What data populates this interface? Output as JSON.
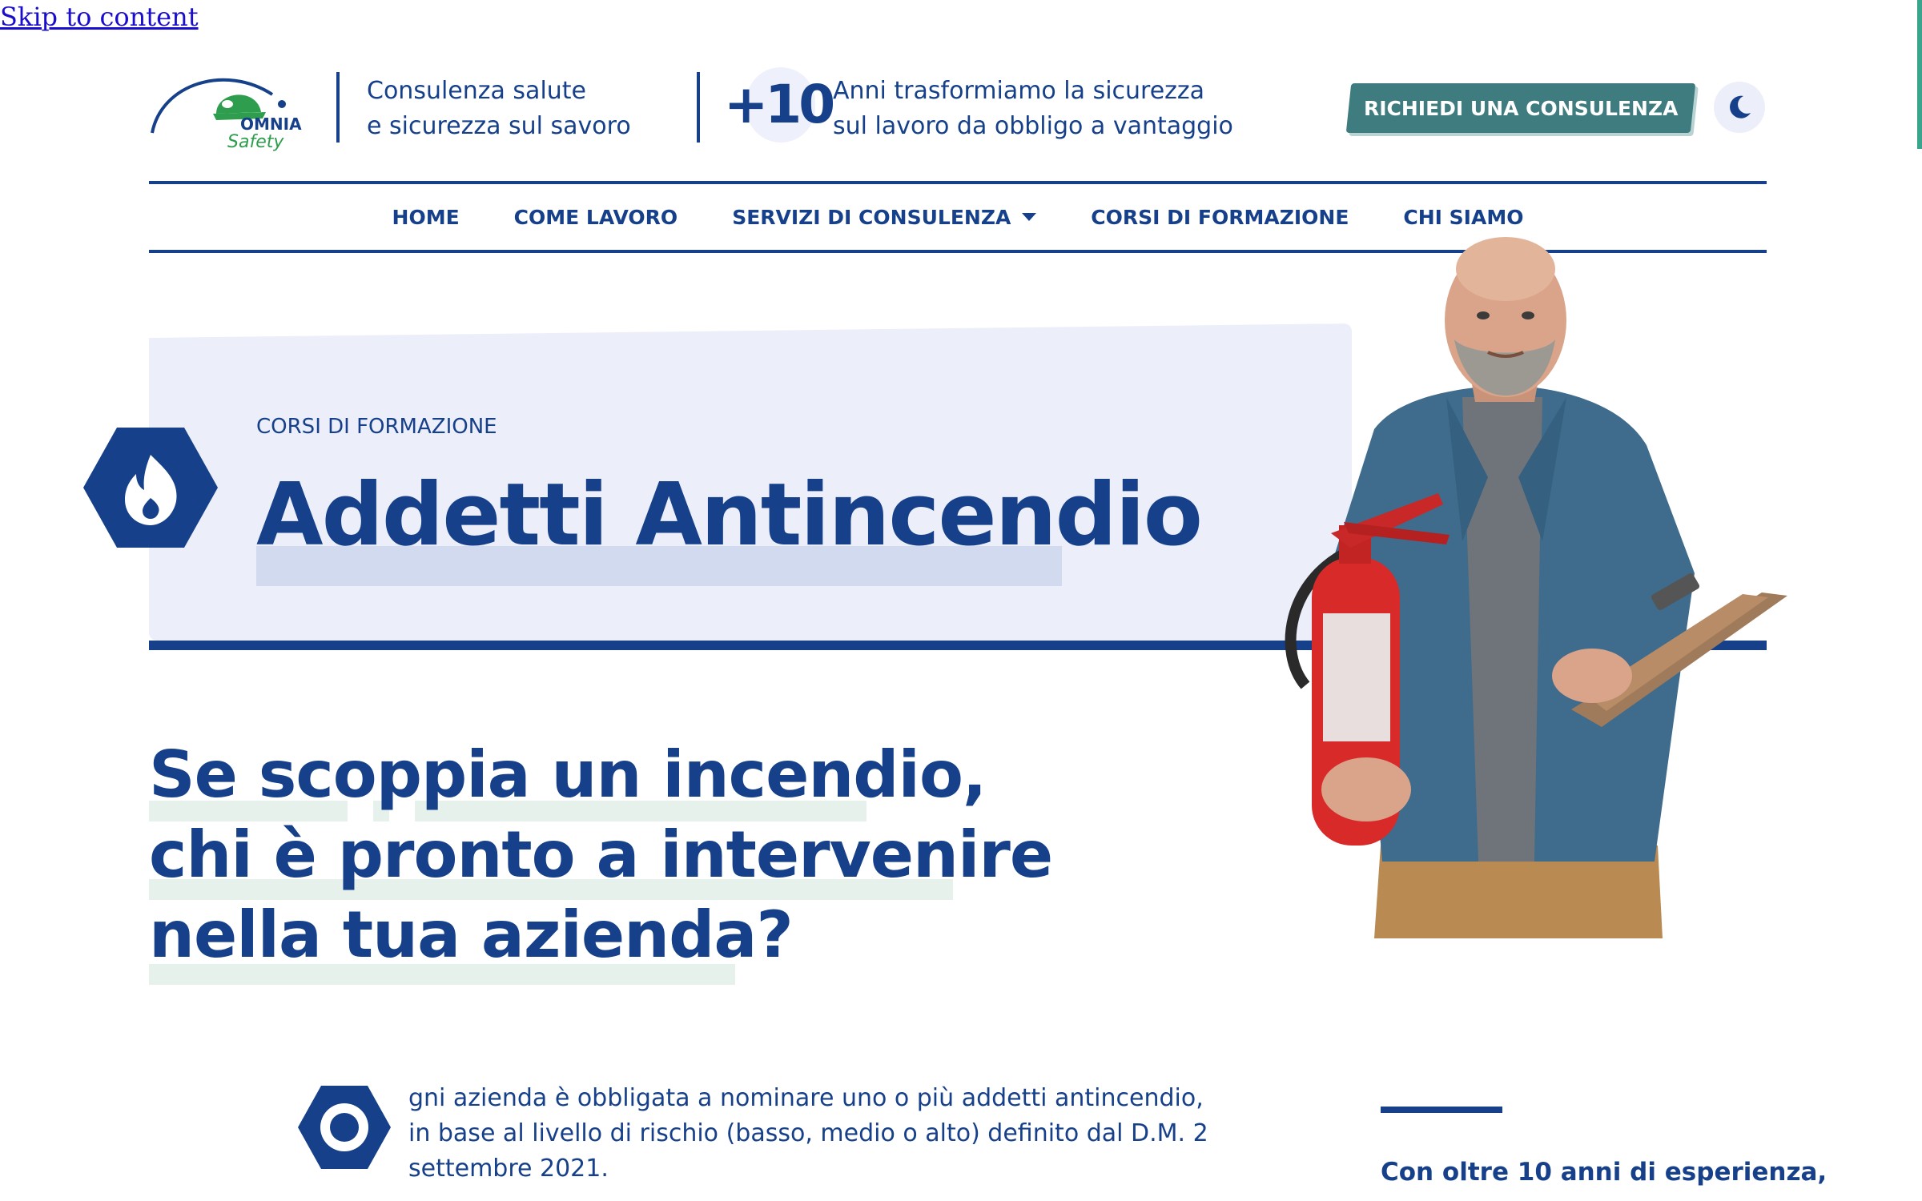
{
  "skip_link": "Skip to content",
  "header": {
    "logo_word": "OMNIA",
    "logo_sub": "Safety",
    "tagline_line1": "Consulenza salute",
    "tagline_line2": "e sicurezza sul savoro",
    "years_number": "+10",
    "years_line1": "Anni trasformiamo la sicurezza",
    "years_line2": "sul lavoro da obbligo a vantaggio",
    "cta_label": "RICHIEDI UNA CONSULENZA"
  },
  "nav": {
    "items": [
      {
        "label": "HOME"
      },
      {
        "label": "COME LAVORO"
      },
      {
        "label": "SERVIZI DI CONSULENZA"
      },
      {
        "label": "CORSI DI FORMAZIONE"
      },
      {
        "label": "CHI SIAMO"
      }
    ]
  },
  "hero": {
    "breadcrumb": "CORSI DI FORMAZIONE",
    "title": "Addetti Antincendio"
  },
  "headline": {
    "line1": "Se scoppia un incendio,",
    "line2": "chi è pronto a intervenire",
    "line3": "nella tua azienda?"
  },
  "intro": {
    "text": "gni azienda è obbligata a nominare uno o più addetti antincendio, in base al livello di rischio (basso, medio o alto) definito dal D.M. 2 settembre 2021."
  },
  "sidebar": {
    "text": "Con oltre 10 anni di esperienza,"
  },
  "colors": {
    "primary": "#16408a",
    "accent_teal": "#3e7c7f",
    "green": "#2e9e4e",
    "hero_bg": "#eceffa",
    "highlight_green": "#e6f1ec"
  }
}
